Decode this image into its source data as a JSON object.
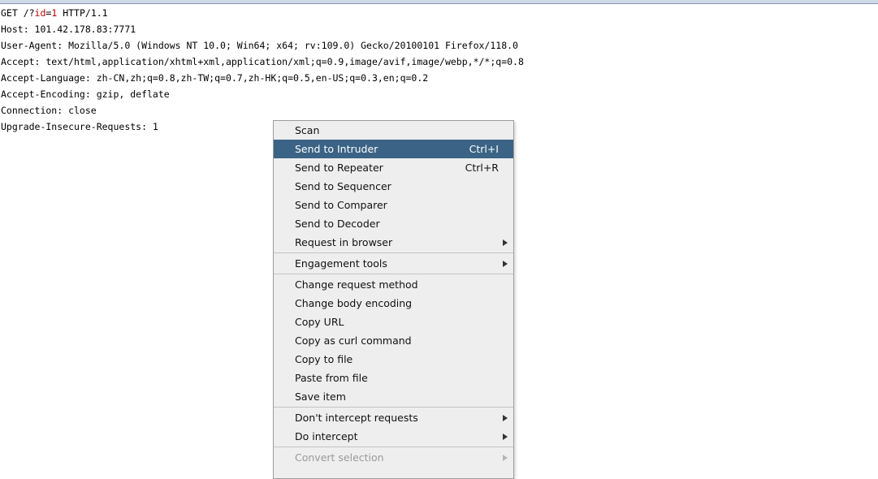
{
  "request": {
    "line1_prefix": "GET /?",
    "line1_param": "id",
    "line1_eq": "=",
    "line1_value": "1",
    "line1_suffix": " HTTP/1.1",
    "host": "Host: 101.42.178.83:7771",
    "user_agent": "User-Agent: Mozilla/5.0 (Windows NT 10.0; Win64; x64; rv:109.0) Gecko/20100101 Firefox/118.0",
    "accept": "Accept: text/html,application/xhtml+xml,application/xml;q=0.9,image/avif,image/webp,*/*;q=0.8",
    "accept_language": "Accept-Language: zh-CN,zh;q=0.8,zh-TW;q=0.7,zh-HK;q=0.5,en-US;q=0.3,en;q=0.2",
    "accept_encoding": "Accept-Encoding: gzip, deflate",
    "connection": "Connection: close",
    "upgrade": "Upgrade-Insecure-Requests: 1"
  },
  "context_menu": {
    "items": [
      {
        "label": "Scan"
      },
      {
        "label": "Send to Intruder",
        "shortcut": "Ctrl+I"
      },
      {
        "label": "Send to Repeater",
        "shortcut": "Ctrl+R"
      },
      {
        "label": "Send to Sequencer"
      },
      {
        "label": "Send to Comparer"
      },
      {
        "label": "Send to Decoder"
      },
      {
        "label": "Request in browser"
      },
      {
        "label": "Engagement tools"
      },
      {
        "label": "Change request method"
      },
      {
        "label": "Change body encoding"
      },
      {
        "label": "Copy URL"
      },
      {
        "label": "Copy as curl command"
      },
      {
        "label": "Copy to file"
      },
      {
        "label": "Paste from file"
      },
      {
        "label": "Save item"
      },
      {
        "label": "Don't intercept requests"
      },
      {
        "label": "Do intercept"
      },
      {
        "label": "Convert selection"
      }
    ]
  },
  "colors": {
    "selection_bg": "#3a6385",
    "param_highlight": "#c00000"
  }
}
